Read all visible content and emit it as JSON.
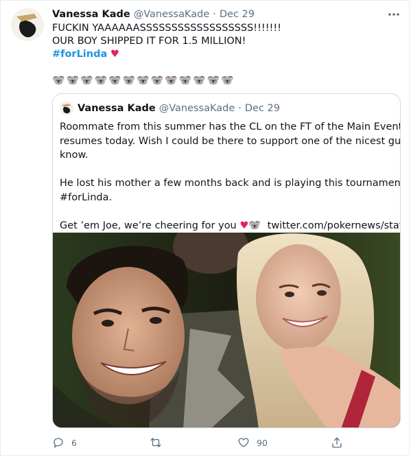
{
  "tweet": {
    "author_name": "Vanessa Kade",
    "author_handle": "@VanessaKade",
    "separator": "·",
    "date": "Dec 29",
    "more_icon": "more-icon",
    "lines": [
      "FUCKIN YAAAAAASSSSSSSSSSSSSSSSSS!!!!!!!",
      "OUR BOY SHIPPED IT FOR 1.5 MILLION!"
    ],
    "hashtag": "#forLinda",
    "heart_glyph": "♥",
    "koala_glyph": "🐨",
    "koala_count": 13
  },
  "quote": {
    "author_name": "Vanessa Kade",
    "author_handle": "@VanessaKade",
    "separator": "·",
    "date": "Dec 29",
    "lines": [
      "Roommate from this summer has the CL on the FT of the Main Event that",
      "resumes today. Wish I could be there to support one of the nicest guys I",
      "know."
    ],
    "lines2": [
      "He lost his mother a few months back and is playing this tournament",
      "#forLinda."
    ],
    "last_line_text": "Get ’em Joe, we’re cheering for you",
    "last_line_heart": "♥",
    "last_line_koala": "🐨",
    "link": "twitter.com/pokernews/stat..."
  },
  "actions": {
    "reply_count": "6",
    "retweet_count": "",
    "like_count": "90",
    "share_count": ""
  },
  "colors": {
    "accent": "#1b95e0",
    "heart": "#e0245e",
    "muted": "#5b7083",
    "border": "#cfd9de"
  }
}
